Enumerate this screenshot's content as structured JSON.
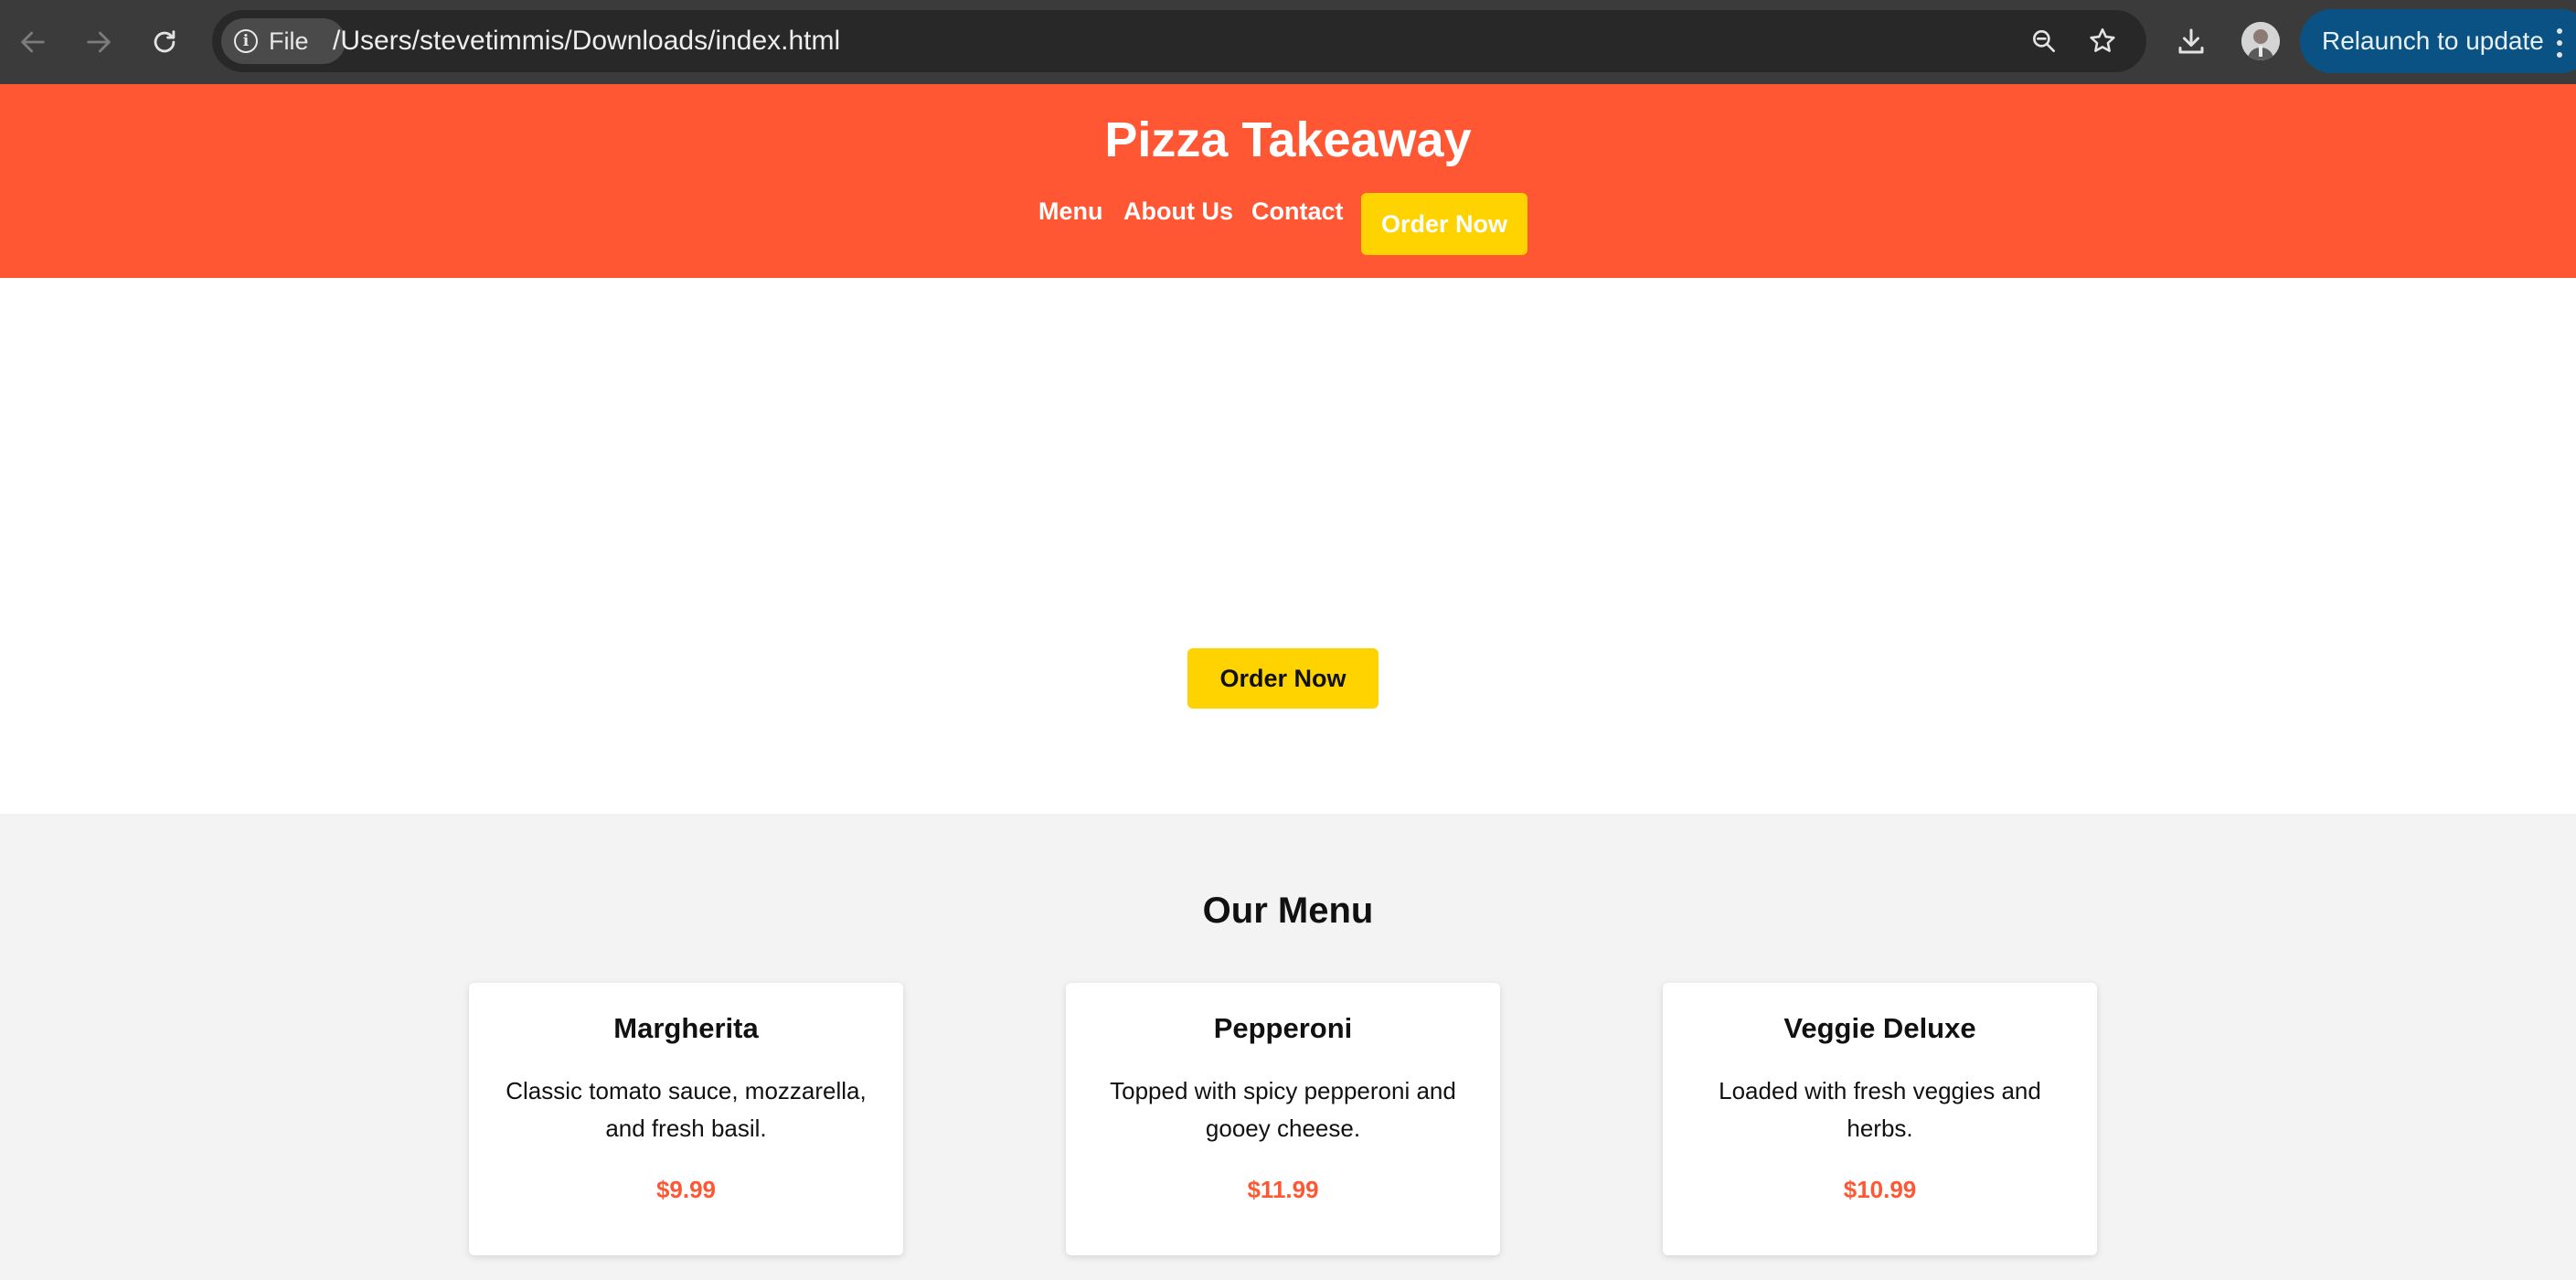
{
  "browser": {
    "file_chip_label": "File",
    "url": "/Users/stevetimmis/Downloads/index.html",
    "relaunch_label": "Relaunch to update",
    "colors": {
      "chrome_bg": "#3b3b3c",
      "omnibox_bg": "#282828",
      "relaunch_bg": "#0b5284"
    },
    "icons": [
      "back-arrow-icon",
      "forward-arrow-icon",
      "reload-icon",
      "info-icon",
      "zoom-out-icon",
      "star-icon",
      "download-icon",
      "avatar",
      "more-vert-icon"
    ]
  },
  "site": {
    "title": "Pizza Takeaway",
    "nav": {
      "menu": "Menu",
      "about": "About Us",
      "contact": "Contact",
      "order": "Order Now"
    },
    "hero_button": "Order Now",
    "menu": {
      "heading": "Our Menu",
      "items": [
        {
          "name": "Margherita",
          "description": "Classic tomato sauce, mozzarella, and fresh basil.",
          "price": "$9.99"
        },
        {
          "name": "Pepperoni",
          "description": "Topped with spicy pepperoni and gooey cheese.",
          "price": "$11.99"
        },
        {
          "name": "Veggie Deluxe",
          "description": "Loaded with fresh veggies and herbs.",
          "price": "$10.99"
        }
      ]
    },
    "colors": {
      "header": "#ff5733",
      "button": "#ffd300",
      "price": "#ff5733",
      "section_bg": "#f3f3f3"
    }
  }
}
